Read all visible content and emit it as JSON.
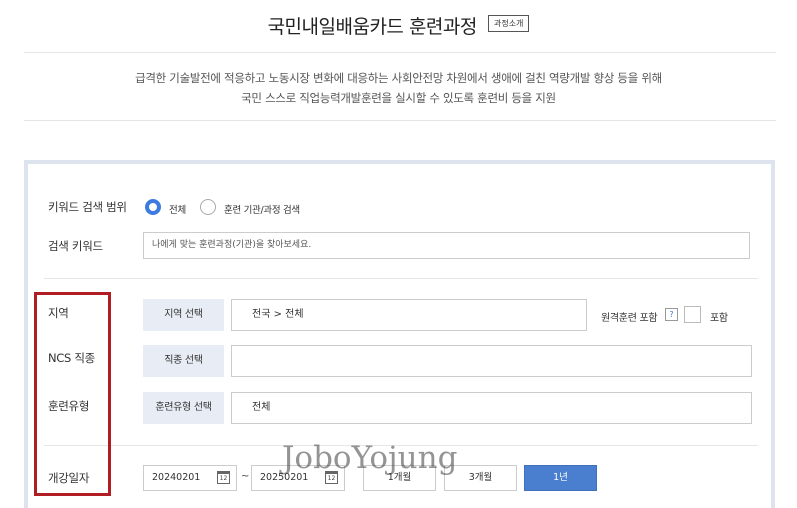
{
  "header": {
    "title": "국민내일배움카드 훈련과정",
    "intro_button": "과정소개"
  },
  "description": {
    "line1": "급격한 기술발전에 적응하고 노동시장 변화에 대응하는 사회안전망 차원에서 생애에 걸친 역량개발 향상 등을 위해",
    "line2": "국민 스스로 직업능력개발훈련을 실시할 수 있도록 훈련비 등을 지원"
  },
  "search": {
    "scope_label": "키워드 검색 범위",
    "scope_options": [
      {
        "label": "전체",
        "selected": true
      },
      {
        "label": "훈련 기관/과정 검색",
        "selected": false
      }
    ],
    "keyword_label": "검색 키워드",
    "keyword_placeholder": "나에게 맞는 훈련과정(기관)을 찾아보세요.",
    "keyword_value": ""
  },
  "filters": {
    "region": {
      "label": "지역",
      "button": "지역 선택",
      "value": "전국 > 전체"
    },
    "remote": {
      "label": "원격훈련 포함",
      "help": "?",
      "check_label": "포함",
      "checked": false
    },
    "ncs": {
      "label": "NCS 직종",
      "button": "직종 선택",
      "value": ""
    },
    "training_type": {
      "label": "훈련유형",
      "button": "훈련유형 선택",
      "value": "전체"
    }
  },
  "dates": {
    "label": "개강일자",
    "start": "20240201",
    "end": "20250201",
    "separator": "~",
    "calendar_glyph": "12",
    "periods": [
      {
        "label": "1개월",
        "active": false
      },
      {
        "label": "3개월",
        "active": false
      },
      {
        "label": "1년",
        "active": true
      }
    ]
  },
  "watermark": "JoboYojung",
  "colors": {
    "accent": "#3d7be0",
    "active_button": "#4a7fd0",
    "highlight_box": "#b01e23",
    "panel_border": "#dde4ee",
    "select_button_bg": "#e8edf5"
  }
}
